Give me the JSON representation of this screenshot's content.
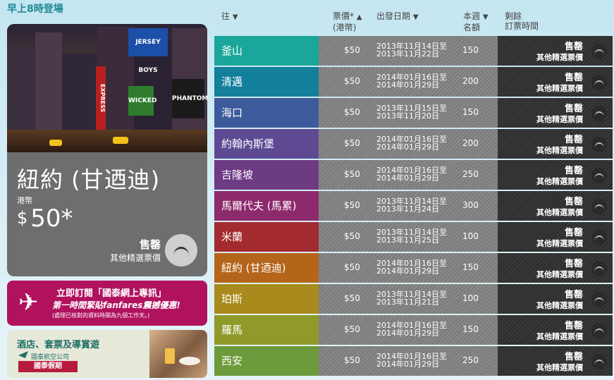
{
  "header": {
    "title": "早上8時登場"
  },
  "featured": {
    "city": "紐約 (甘迺迪)",
    "currency_label": "港幣",
    "price_symbol": "$",
    "price_value": "50*",
    "status": "售罄",
    "other_fares": "其他精選票價",
    "photo_signs": [
      "JERSEY BOYS",
      "WICKED",
      "PHANTOM",
      "EXPRESS"
    ]
  },
  "promo": {
    "line1": "立即訂閱「國泰網上專訊」",
    "line2": "第一時間緊貼fanfares震撼優惠!",
    "line3": "(處理已核對的資料時間為九個工作天。)"
  },
  "holiday": {
    "title": "酒店、套票及導賞遊",
    "logo_text": "國泰航空公司",
    "badge": "國泰假期"
  },
  "table": {
    "headers": {
      "dest": "往",
      "price_1": "票價*",
      "price_2": "(港幣)",
      "date": "出發日期",
      "seats_1": "本週",
      "seats_2": "名額",
      "remain_1": "剩餘",
      "remain_2": "訂票時間"
    },
    "rows": [
      {
        "dest": "釜山",
        "color": "#1aa69a",
        "price": "$50",
        "date_from": "2013年11月14日至",
        "date_to": "2013年11月22日",
        "seats": "150",
        "status": "售罄",
        "other": "其他精選票價"
      },
      {
        "dest": "清邁",
        "color": "#127f9b",
        "price": "$50",
        "date_from": "2014年01月16日至",
        "date_to": "2014年01月29日",
        "seats": "200",
        "status": "售罄",
        "other": "其他精選票價"
      },
      {
        "dest": "海口",
        "color": "#3d5a9c",
        "price": "$50",
        "date_from": "2013年11月15日至",
        "date_to": "2013年11月20日",
        "seats": "150",
        "status": "售罄",
        "other": "其他精選票價"
      },
      {
        "dest": "約翰內斯堡",
        "color": "#5e4a93",
        "price": "$50",
        "date_from": "2014年01月16日至",
        "date_to": "2014年01月29日",
        "seats": "200",
        "status": "售罄",
        "other": "其他精選票價"
      },
      {
        "dest": "吉隆坡",
        "color": "#6d3a84",
        "price": "$50",
        "date_from": "2014年01月16日至",
        "date_to": "2014年01月29日",
        "seats": "250",
        "status": "售罄",
        "other": "其他精選票價"
      },
      {
        "dest": "馬爾代夫 (馬累)",
        "color": "#8c2a6c",
        "price": "$50",
        "date_from": "2013年11月14日至",
        "date_to": "2013年11月24日",
        "seats": "300",
        "status": "售罄",
        "other": "其他精選票價"
      },
      {
        "dest": "米蘭",
        "color": "#a32a2e",
        "price": "$50",
        "date_from": "2013年11月14日至",
        "date_to": "2013年11月25日",
        "seats": "100",
        "status": "售罄",
        "other": "其他精選票價"
      },
      {
        "dest": "紐約 (甘迺迪)",
        "color": "#b5651a",
        "price": "$50",
        "date_from": "2014年01月16日至",
        "date_to": "2014年01月29日",
        "seats": "150",
        "status": "售罄",
        "other": "其他精選票價"
      },
      {
        "dest": "珀斯",
        "color": "#a98a1c",
        "price": "$50",
        "date_from": "2013年11月14日至",
        "date_to": "2013年11月21日",
        "seats": "100",
        "status": "售罄",
        "other": "其他精選票價"
      },
      {
        "dest": "羅馬",
        "color": "#8f9a2a",
        "price": "$50",
        "date_from": "2014年01月16日至",
        "date_to": "2014年01月29日",
        "seats": "150",
        "status": "售罄",
        "other": "其他精選票價"
      },
      {
        "dest": "西安",
        "color": "#6d9a3a",
        "price": "$50",
        "date_from": "2014年01月16日至",
        "date_to": "2014年01月29日",
        "seats": "250",
        "status": "售罄",
        "other": "其他精選票價"
      }
    ]
  }
}
